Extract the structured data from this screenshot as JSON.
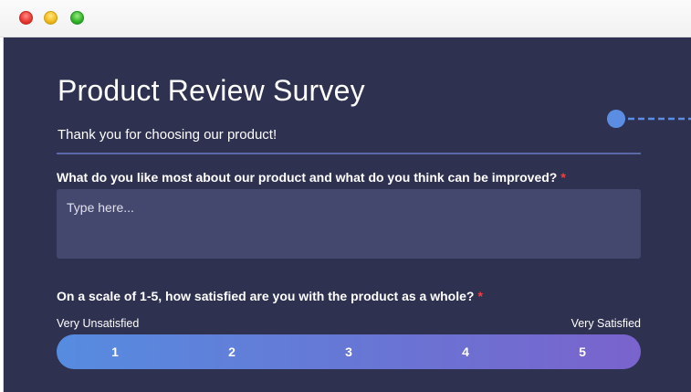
{
  "survey": {
    "title": "Product Review Survey",
    "subtitle": "Thank you for choosing our product!"
  },
  "question1": {
    "label": "What do you like most about our product and what do you think can be improved?",
    "required_mark": "*",
    "placeholder": "Type here...",
    "value": ""
  },
  "question2": {
    "label": "On a scale of 1-5, how satisfied are you with the product as a whole?",
    "required_mark": "*",
    "scale_min_label": "Very Unsatisfied",
    "scale_max_label": "Very Satisfied",
    "options": [
      "1",
      "2",
      "3",
      "4",
      "5"
    ]
  },
  "colors": {
    "background": "#2e3150",
    "input_background": "#45486e",
    "accent": "#5b8ee2",
    "required": "#ff3a3a",
    "scale_start": "#568ce0",
    "scale_end": "#7a63cd"
  },
  "icons": {
    "window_controls": [
      "close-icon",
      "minimize-icon",
      "maximize-icon"
    ],
    "connector": "progress-dot-icon"
  }
}
